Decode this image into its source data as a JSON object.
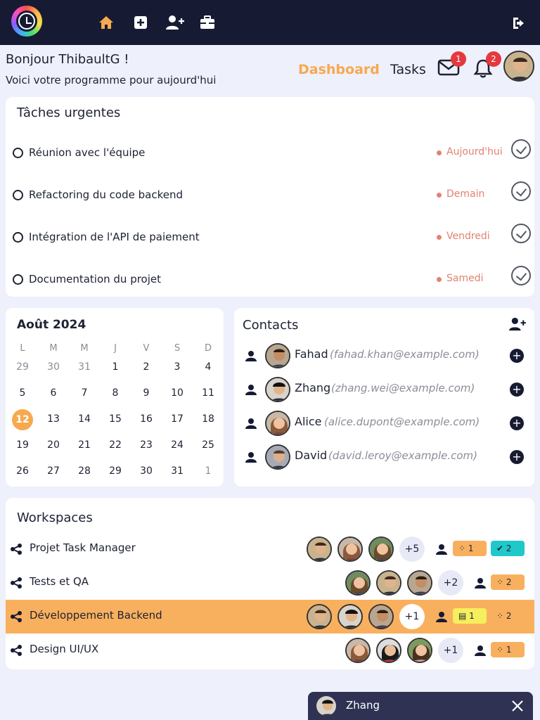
{
  "nav": {
    "icons": [
      "home-icon",
      "add-square-icon",
      "add-user-icon",
      "briefcase-icon",
      "logout-icon"
    ],
    "active_color": "#f6a94f"
  },
  "header": {
    "greeting": "Bonjour ThibaultG !",
    "subtitle": "Voici votre programme pour aujourd'hui",
    "links": [
      "Dashboard",
      "Tasks"
    ],
    "mail_badge": "1",
    "bell_badge": "2"
  },
  "urgent": {
    "title": "Tâches urgentes",
    "tasks": [
      {
        "label": "Réunion avec l'équipe",
        "due": "Aujourd'hui"
      },
      {
        "label": "Refactoring du code backend",
        "due": "Demain"
      },
      {
        "label": "Intégration de l'API de paiement",
        "due": "Vendredi"
      },
      {
        "label": "Documentation du projet",
        "due": "Samedi"
      }
    ]
  },
  "calendar": {
    "month": "Août 2024",
    "days_of_week": [
      "L",
      "M",
      "M",
      "J",
      "V",
      "S",
      "D"
    ],
    "weeks": [
      [
        "29",
        "30",
        "31",
        "1",
        "2",
        "3",
        "4"
      ],
      [
        "5",
        "6",
        "7",
        "8",
        "9",
        "10",
        "11"
      ],
      [
        "12",
        "13",
        "14",
        "15",
        "16",
        "17",
        "18"
      ],
      [
        "19",
        "20",
        "21",
        "22",
        "23",
        "24",
        "25"
      ],
      [
        "26",
        "27",
        "28",
        "29",
        "30",
        "31",
        "1"
      ]
    ],
    "today": "12"
  },
  "contacts": {
    "title": "Contacts",
    "items": [
      {
        "name": "Fahad",
        "email": "(fahad.khan@example.com)"
      },
      {
        "name": "Zhang",
        "email": "(zhang.wei@example.com)"
      },
      {
        "name": "Alice",
        "email": "(alice.dupont@example.com)"
      },
      {
        "name": "David",
        "email": "(david.leroy@example.com)"
      }
    ]
  },
  "workspaces": {
    "title": "Workspaces",
    "items": [
      {
        "name": "Projet Task Manager",
        "more": "+5",
        "badges": [
          "1",
          "2"
        ]
      },
      {
        "name": "Tests et QA",
        "more": "+2",
        "badges": [
          "2"
        ]
      },
      {
        "name": "Développement Backend",
        "more": "+1",
        "badges": [
          "1",
          "2"
        ]
      },
      {
        "name": "Design UI/UX",
        "more": "+1",
        "badges": [
          "1"
        ]
      }
    ]
  },
  "chat": {
    "name": "Zhang"
  }
}
